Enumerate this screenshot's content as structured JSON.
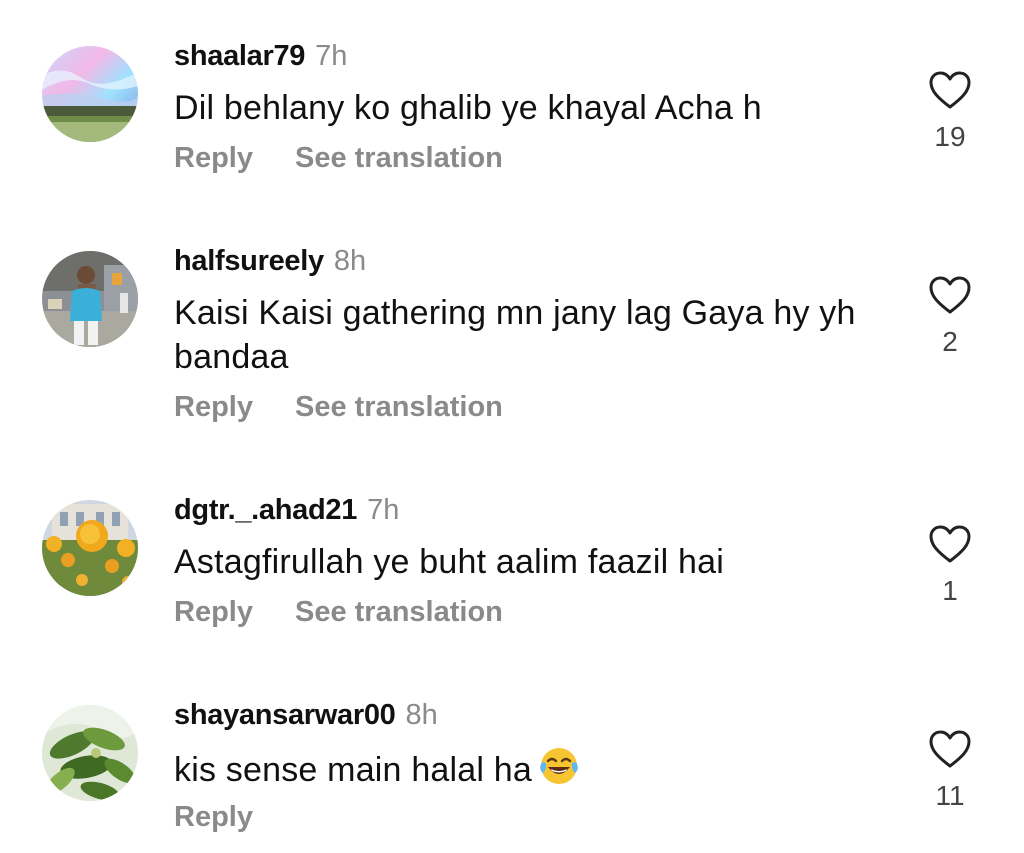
{
  "comments": [
    {
      "username": "shaalar79",
      "time": "7h",
      "text": "Dil behlany ko ghalib ye khayal Acha h",
      "reply_label": "Reply",
      "translate_label": "See translation",
      "likes": "19",
      "avatar_icon": "aurora-landscape-avatar"
    },
    {
      "username": "halfsureely",
      "time": "8h",
      "text": "Kaisi Kaisi gathering mn jany lag Gaya  hy yh bandaa",
      "reply_label": "Reply",
      "translate_label": "See translation",
      "likes": "2",
      "avatar_icon": "person-photo-avatar"
    },
    {
      "username": "dgtr._.ahad21",
      "time": "7h",
      "text": "Astagfirullah ye buht aalim faazil hai",
      "reply_label": "Reply",
      "translate_label": "See translation",
      "likes": "1",
      "avatar_icon": "flowers-building-avatar"
    },
    {
      "username": "shayansarwar00",
      "time": "8h",
      "text": "kis sense main halal ha",
      "emoji": "face-with-tears-of-joy",
      "reply_label": "Reply",
      "likes": "11",
      "avatar_icon": "leaves-avatar"
    }
  ],
  "colors": {
    "username": "#111111",
    "muted": "#8a8a8a",
    "count": "#444444",
    "heart_stroke": "#222222"
  }
}
